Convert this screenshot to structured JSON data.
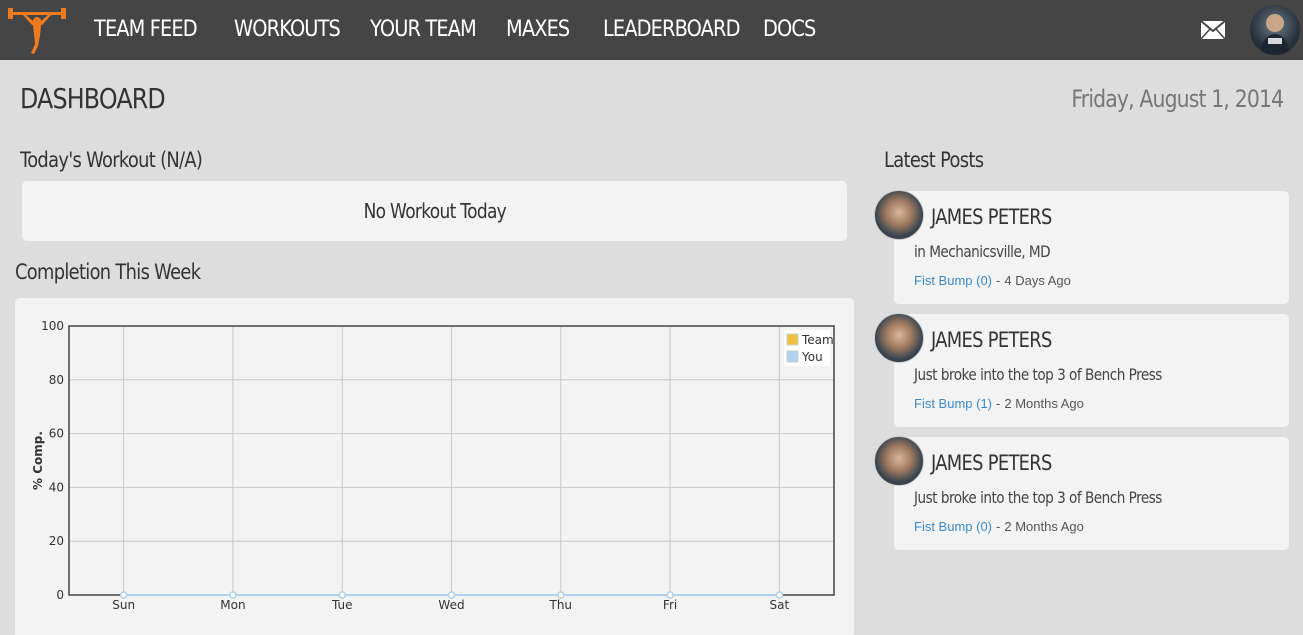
{
  "nav": {
    "items": [
      "TEAM FEED",
      "WORKOUTS",
      "YOUR TEAM",
      "MAXES",
      "LEADERBOARD",
      "DOCS"
    ],
    "logo_icon": "weightlifter-icon",
    "mail_icon": "mail-icon",
    "accent": "#f07b1f"
  },
  "header": {
    "title": "DASHBOARD",
    "date": "Friday, August 1, 2014"
  },
  "workout": {
    "title": "Today's Workout (N/A)",
    "message": "No Workout Today"
  },
  "completion": {
    "title": "Completion This Week"
  },
  "chart_data": {
    "type": "line",
    "x": [
      "Sun",
      "Mon",
      "Tue",
      "Wed",
      "Thu",
      "Fri",
      "Sat"
    ],
    "series": [
      {
        "name": "Team",
        "color": "#f0c040",
        "values": [
          0,
          0,
          0,
          0,
          0,
          0,
          0
        ]
      },
      {
        "name": "You",
        "color": "#aed2f0",
        "values": [
          0,
          0,
          0,
          0,
          0,
          0,
          0
        ]
      }
    ],
    "ylabel": "% Comp.",
    "xlabel": "",
    "ylim": [
      0,
      100
    ],
    "yticks": [
      0,
      20,
      40,
      60,
      80,
      100
    ],
    "grid": true,
    "legend": "top-right"
  },
  "posts": {
    "title": "Latest Posts",
    "items": [
      {
        "name": "JAMES PETERS",
        "text": "in Mechanicsville, MD",
        "fist": "Fist Bump (0)",
        "sep": "-",
        "time": "4 Days Ago"
      },
      {
        "name": "JAMES PETERS",
        "text": "Just broke into the top 3 of Bench Press",
        "fist": "Fist Bump (1)",
        "sep": "-",
        "time": "2 Months Ago"
      },
      {
        "name": "JAMES PETERS",
        "text": "Just broke into the top 3 of Bench Press",
        "fist": "Fist Bump (0)",
        "sep": "-",
        "time": "2 Months Ago"
      }
    ]
  }
}
